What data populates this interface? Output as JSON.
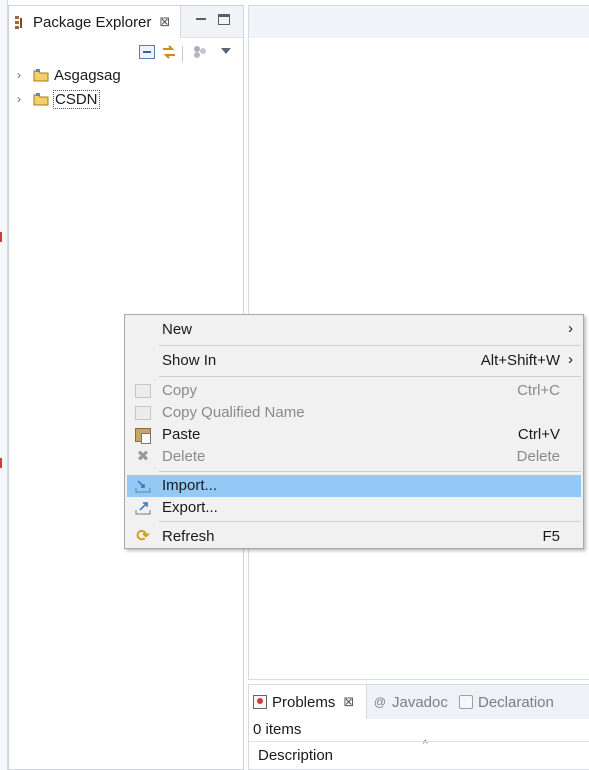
{
  "package_explorer": {
    "title": "Package Explorer",
    "close_glyph": "⊠",
    "toolbar_icons": [
      "collapse-all-icon",
      "link-with-editor-icon",
      "view-menu-dots-icon",
      "chevron-down-icon"
    ],
    "projects": [
      {
        "label": "Asgagsag",
        "expanded": false
      },
      {
        "label": "CSDN",
        "expanded": false,
        "focused": true
      }
    ]
  },
  "context_menu": {
    "items": [
      {
        "label": "New",
        "accelerator": "",
        "submenu": true,
        "enabled": true
      },
      {
        "label": "Show In",
        "accelerator": "Alt+Shift+W",
        "submenu": true,
        "enabled": true
      },
      {
        "label": "Copy",
        "accelerator": "Ctrl+C",
        "enabled": false,
        "icon": "copy-icon"
      },
      {
        "label": "Copy Qualified Name",
        "accelerator": "",
        "enabled": false,
        "icon": "copy-qualified-name-icon"
      },
      {
        "label": "Paste",
        "accelerator": "Ctrl+V",
        "enabled": true,
        "icon": "paste-icon"
      },
      {
        "label": "Delete",
        "accelerator": "Delete",
        "enabled": false,
        "icon": "delete-icon"
      },
      {
        "label": "Import...",
        "accelerator": "",
        "enabled": true,
        "highlighted": true,
        "icon": "import-icon"
      },
      {
        "label": "Export...",
        "accelerator": "",
        "enabled": true,
        "icon": "export-icon"
      },
      {
        "label": "Refresh",
        "accelerator": "F5",
        "enabled": true,
        "icon": "refresh-icon"
      }
    ],
    "submenu_arrow": "›",
    "highlight_color": "#94c8f5"
  },
  "bottom_panel": {
    "tabs": [
      {
        "label": "Problems",
        "active": true,
        "icon": "problems-icon"
      },
      {
        "label": "Javadoc",
        "active": false,
        "icon": "at-sign-icon"
      },
      {
        "label": "Declaration",
        "active": false,
        "icon": "declaration-icon"
      }
    ],
    "status": "0 items",
    "column_header": "Description"
  },
  "colors": {
    "selection": "#94c8f5",
    "disabled_text": "#8a8a8a",
    "menu_background": "#f1f1f1"
  }
}
